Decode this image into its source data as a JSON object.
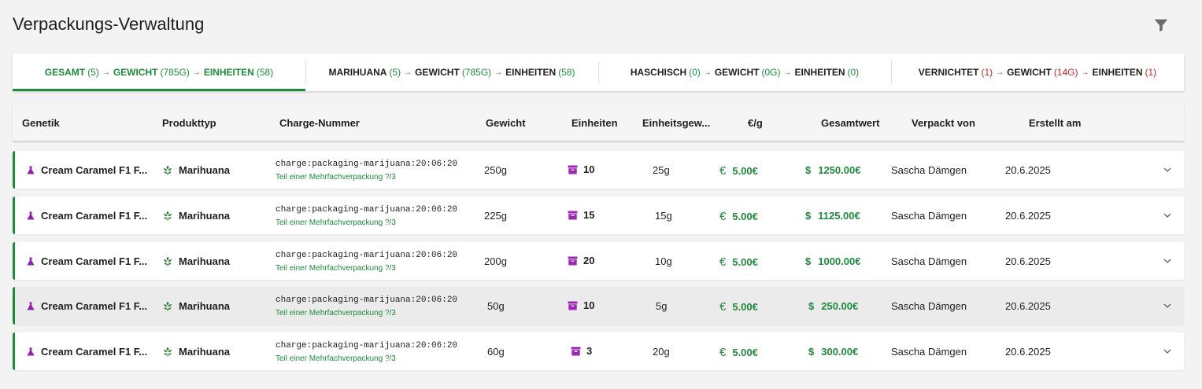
{
  "page": {
    "title": "Verpackungs-Verwaltung",
    "filter_icon": "filter-icon"
  },
  "tabs": [
    {
      "label": "GESAMT",
      "count": "(5)",
      "w_label": "GEWICHT",
      "w_val": "(785G)",
      "e_label": "EINHEITEN",
      "e_val": "(58)",
      "active": true
    },
    {
      "label": "MARIHUANA",
      "count": "(5)",
      "w_label": "GEWICHT",
      "w_val": "(785G)",
      "e_label": "EINHEITEN",
      "e_val": "(58)",
      "active": false
    },
    {
      "label": "HASCHISCH",
      "count": "(0)",
      "w_label": "GEWICHT",
      "w_val": "(0G)",
      "e_label": "EINHEITEN",
      "e_val": "(0)",
      "active": false
    },
    {
      "label": "VERNICHTET",
      "count": "(1)",
      "w_label": "GEWICHT",
      "w_val": "(14G)",
      "e_label": "EINHEITEN",
      "e_val": "(1)",
      "active": false
    }
  ],
  "columns": [
    "Genetik",
    "Produkttyp",
    "Charge-Nummer",
    "Gewicht",
    "Einheiten",
    "Einheitsgew...",
    "€/g",
    "Gesamtwert",
    "Verpackt von",
    "Erstellt am"
  ],
  "rows": [
    {
      "genetik": "Cream Caramel F1 F...",
      "produkttyp": "Marihuana",
      "charge": "charge:packaging-marijuana:20:06:20",
      "sub": "Teil einer Mehrfachverpackung ?/3",
      "gewicht": "250g",
      "einheiten": "10",
      "einheitsgewicht": "25g",
      "preis": "5.00€",
      "gesamtwert": "1250.00€",
      "verpackt_von": "Sascha Dämgen",
      "erstellt_am": "20.6.2025"
    },
    {
      "genetik": "Cream Caramel F1 F...",
      "produkttyp": "Marihuana",
      "charge": "charge:packaging-marijuana:20:06:20",
      "sub": "Teil einer Mehrfachverpackung ?/3",
      "gewicht": "225g",
      "einheiten": "15",
      "einheitsgewicht": "15g",
      "preis": "5.00€",
      "gesamtwert": "1125.00€",
      "verpackt_von": "Sascha Dämgen",
      "erstellt_am": "20.6.2025"
    },
    {
      "genetik": "Cream Caramel F1 F...",
      "produkttyp": "Marihuana",
      "charge": "charge:packaging-marijuana:20:06:20",
      "sub": "Teil einer Mehrfachverpackung ?/3",
      "gewicht": "200g",
      "einheiten": "20",
      "einheitsgewicht": "10g",
      "preis": "5.00€",
      "gesamtwert": "1000.00€",
      "verpackt_von": "Sascha Dämgen",
      "erstellt_am": "20.6.2025"
    },
    {
      "genetik": "Cream Caramel F1 F...",
      "produkttyp": "Marihuana",
      "charge": "charge:packaging-marijuana:20:06:20",
      "sub": "Teil einer Mehrfachverpackung ?/3",
      "gewicht": "50g",
      "einheiten": "10",
      "einheitsgewicht": "5g",
      "preis": "5.00€",
      "gesamtwert": "250.00€",
      "verpackt_von": "Sascha Dämgen",
      "erstellt_am": "20.6.2025"
    },
    {
      "genetik": "Cream Caramel F1 F...",
      "produkttyp": "Marihuana",
      "charge": "charge:packaging-marijuana:20:06:20",
      "sub": "Teil einer Mehrfachverpackung ?/3",
      "gewicht": "60g",
      "einheiten": "3",
      "einheitsgewicht": "20g",
      "preis": "5.00€",
      "gesamtwert": "300.00€",
      "verpackt_von": "Sascha Dämgen",
      "erstellt_am": "20.6.2025"
    }
  ],
  "symbols": {
    "euro": "€",
    "dollar": "$",
    "arrow": "→"
  },
  "colors": {
    "accent_green": "#1e8a3c",
    "danger_red": "#c62828",
    "box_purple": "#9c27b0"
  }
}
